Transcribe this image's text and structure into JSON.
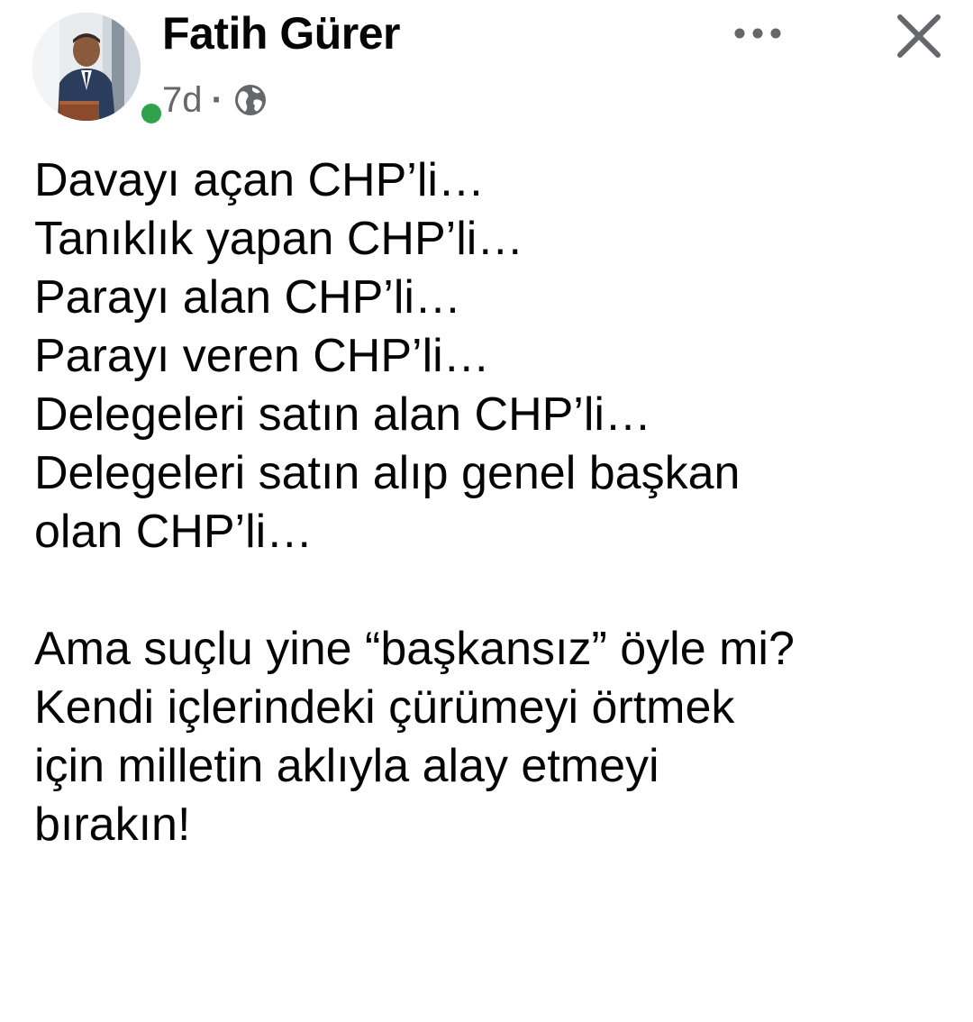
{
  "post": {
    "author": "Fatih Gürer",
    "time": "7d",
    "separator": "·",
    "audience_icon": "globe-icon",
    "online_indicator_color": "#31a24c",
    "more_icon": "more-dots-icon",
    "close_icon": "close-icon",
    "lines": [
      "Davayı açan CHP’li…",
      "Tanıklık yapan CHP’li…",
      "Parayı alan CHP’li…",
      "Parayı veren CHP’li…",
      "Delegeleri satın alan CHP’li…",
      "Delegeleri satın alıp genel başkan",
      "olan CHP’li…",
      "",
      "Ama suçlu yine “başkansız” öyle mi?",
      "Kendi içlerindeki çürümeyi örtmek",
      "için milletin aklıyla alay etmeyi",
      "bırakın!"
    ]
  },
  "colors": {
    "text": "#050505",
    "secondary_text": "#65676b",
    "background": "#ffffff"
  }
}
